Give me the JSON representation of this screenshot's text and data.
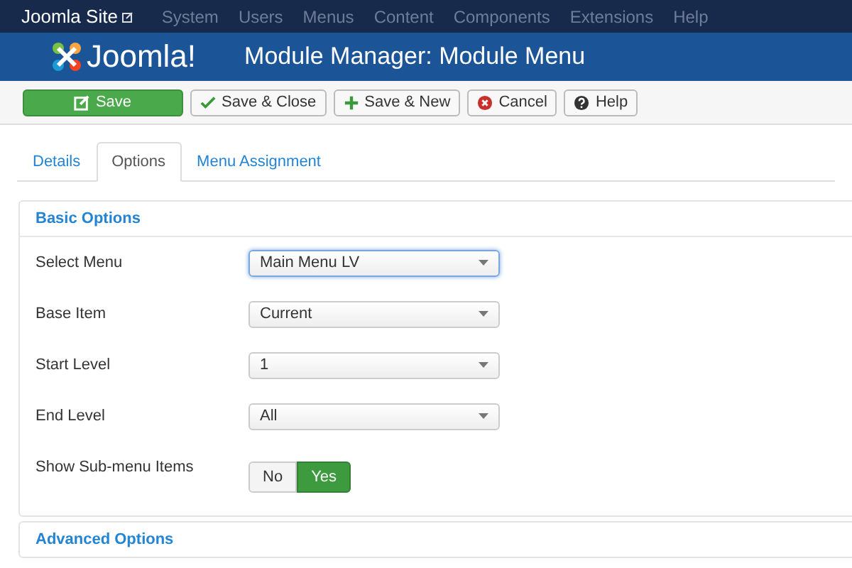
{
  "navbar": {
    "site": "Joomla Site",
    "menu": [
      "System",
      "Users",
      "Menus",
      "Content",
      "Components",
      "Extensions",
      "Help"
    ]
  },
  "header": {
    "logo": "Joomla!",
    "title": "Module Manager: Module Menu"
  },
  "toolbar": [
    {
      "label": "Save",
      "kind": "save"
    },
    {
      "label": "Save & Close",
      "kind": "check"
    },
    {
      "label": "Save & New",
      "kind": "plus"
    },
    {
      "label": "Cancel",
      "kind": "cancel"
    },
    {
      "label": "Help",
      "kind": "help"
    }
  ],
  "tabs": [
    {
      "label": "Details",
      "selected": false
    },
    {
      "label": "Options",
      "selected": true
    },
    {
      "label": "Menu Assignment",
      "selected": false
    }
  ],
  "basic": {
    "title": "Basic Options",
    "fields": [
      {
        "label": "Select Menu",
        "kind": "select",
        "value": "Main Menu LV",
        "focused": true
      },
      {
        "label": "Base Item",
        "kind": "select",
        "value": "Current",
        "focused": false
      },
      {
        "label": "Start Level",
        "kind": "select",
        "value": "1",
        "focused": false
      },
      {
        "label": "End Level",
        "kind": "select",
        "value": "All",
        "focused": false
      },
      {
        "label": "Show Sub-menu Items",
        "kind": "toggle",
        "options": [
          {
            "label": "No",
            "selected": false
          },
          {
            "label": "Yes",
            "selected": true
          }
        ]
      }
    ]
  },
  "advanced": {
    "title": "Advanced Options"
  }
}
